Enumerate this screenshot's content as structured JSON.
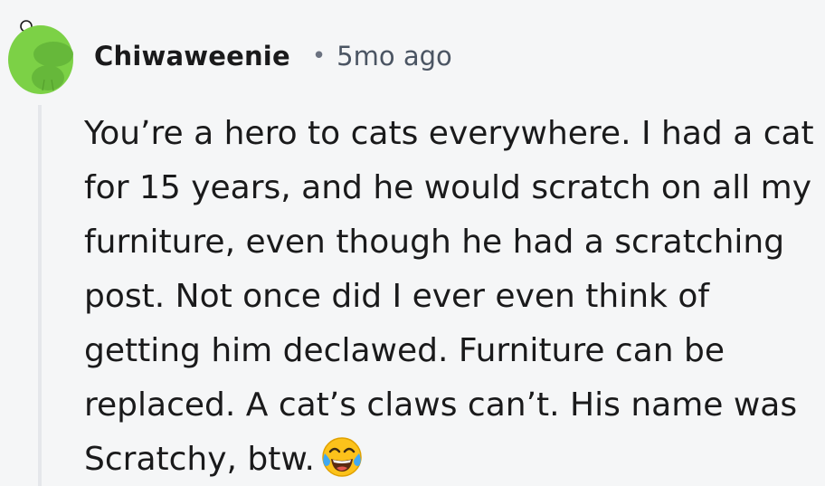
{
  "comment": {
    "author": "Chiwaweenie",
    "separator": "•",
    "timestamp": "5mo ago",
    "avatar_icon": "reddit-snoo-avatar-icon",
    "avatar_color": "#7cd146",
    "body_lines": [
      "You’re a hero to cats everywhere. I had a cat",
      "for 15 years, and he would scratch on all my",
      "furniture, even though he had a scratching",
      "post. Not once did I ever even think of",
      "getting him declawed. Furniture can be",
      "replaced. A cat’s claws can’t. His name was",
      "Scratchy, btw."
    ],
    "emoji_icon": "face-with-tears-of-joy-icon"
  }
}
